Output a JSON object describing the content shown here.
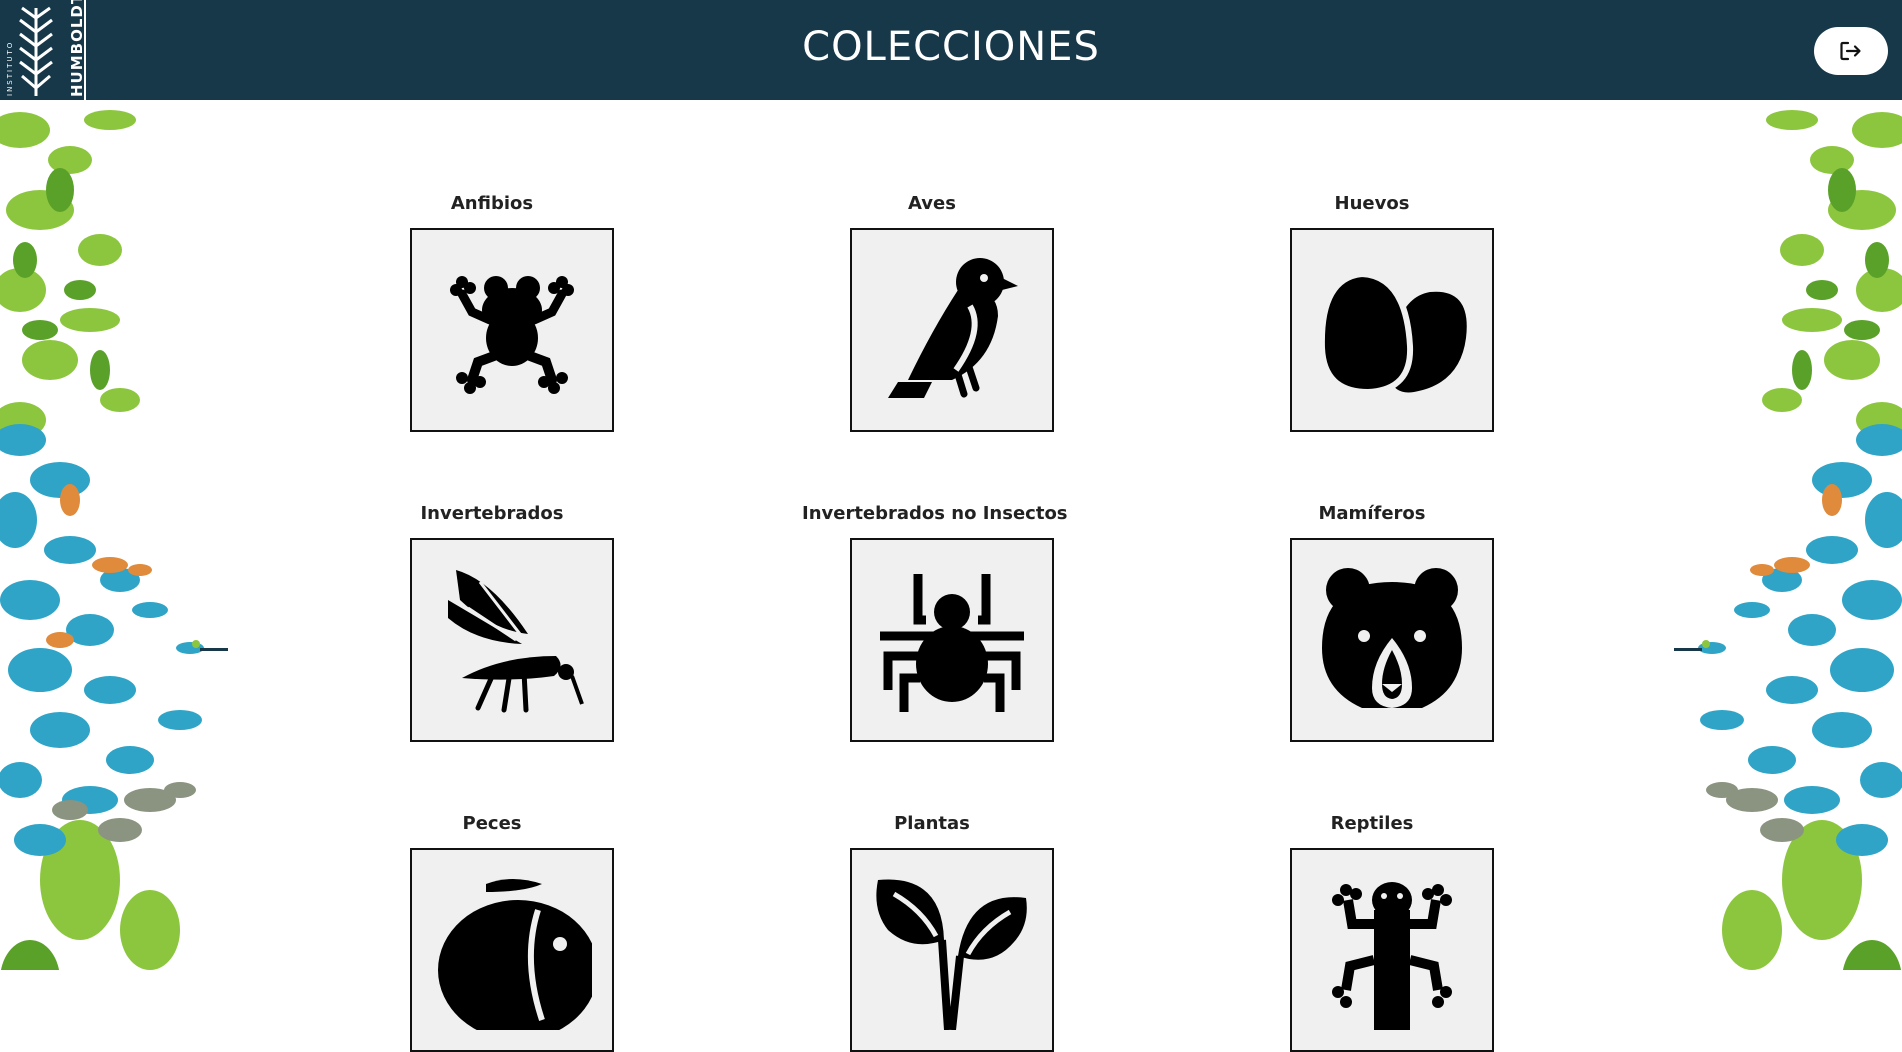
{
  "header": {
    "title": "COLECCIONES",
    "logo": {
      "line1": "INSTITUTO",
      "line2": "HUMBOLDT"
    },
    "logout": {
      "icon": "logout-icon"
    },
    "colors": {
      "header_bg": "#163849",
      "text": "#ffffff"
    }
  },
  "collections": [
    {
      "label": "Anfibios",
      "icon": "frog-icon"
    },
    {
      "label": "Aves",
      "icon": "bird-icon"
    },
    {
      "label": "Huevos",
      "icon": "eggs-icon"
    },
    {
      "label": "Invertebrados",
      "icon": "mosquito-icon"
    },
    {
      "label": "Invertebrados no Insectos",
      "icon": "spider-icon"
    },
    {
      "label": "Mamíferos",
      "icon": "bear-icon"
    },
    {
      "label": "Peces",
      "icon": "fish-icon"
    },
    {
      "label": "Plantas",
      "icon": "plant-icon"
    },
    {
      "label": "Reptiles",
      "icon": "lizard-icon"
    }
  ],
  "decoration": {
    "colors": [
      "#8cc63f",
      "#5aa12a",
      "#2fa4c7",
      "#e08a3c",
      "#8b9480"
    ]
  }
}
